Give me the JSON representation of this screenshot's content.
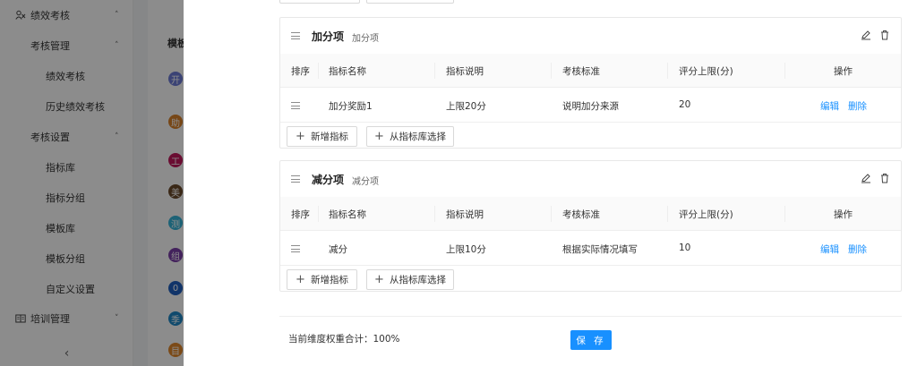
{
  "sidebar": {
    "items": [
      {
        "label": "绩效考核",
        "icon": "performance-icon",
        "chevron": "˄"
      },
      {
        "label": "考核管理",
        "chevron": "˄"
      },
      {
        "label": "绩效考核"
      },
      {
        "label": "历史绩效考核"
      },
      {
        "label": "考核设置",
        "chevron": "˄"
      },
      {
        "label": "指标库"
      },
      {
        "label": "指标分组"
      },
      {
        "label": "模板库"
      },
      {
        "label": "模板分组"
      },
      {
        "label": "自定义设置"
      },
      {
        "label": "培训管理",
        "icon": "book-icon",
        "chevron": "˅"
      }
    ],
    "collapse_label": "‹"
  },
  "background": {
    "column_header": "模板",
    "avatars": [
      {
        "char": "开",
        "color": "#6c7bd6"
      },
      {
        "char": "助",
        "color": "#d9822b"
      },
      {
        "char": "工",
        "color": "#c2185b"
      },
      {
        "char": "美",
        "color": "#6b4a2b"
      },
      {
        "char": "测",
        "color": "#35b3d8"
      },
      {
        "char": "组",
        "color": "#7b3ea8"
      },
      {
        "char": "0",
        "color": "#1f5fbf"
      },
      {
        "char": "季",
        "color": "#1e88c7"
      },
      {
        "char": "目",
        "color": "#e0872a"
      }
    ]
  },
  "sections": [
    {
      "title": "加分项",
      "subtitle": "加分项",
      "columns": [
        "排序",
        "指标名称",
        "指标说明",
        "考核标准",
        "评分上限(分)",
        "操作"
      ],
      "rows": [
        {
          "name": "加分奖励1",
          "desc": "上限20分",
          "standard": "说明加分来源",
          "max": "20",
          "edit": "编辑",
          "delete": "删除"
        }
      ],
      "add_label": "新增指标",
      "library_label": "从指标库选择"
    },
    {
      "title": "减分项",
      "subtitle": "减分项",
      "columns": [
        "排序",
        "指标名称",
        "指标说明",
        "考核标准",
        "评分上限(分)",
        "操作"
      ],
      "rows": [
        {
          "name": "减分",
          "desc": "上限10分",
          "standard": "根据实际情况填写",
          "max": "10",
          "edit": "编辑",
          "delete": "删除"
        }
      ],
      "add_label": "新增指标",
      "library_label": "从指标库选择"
    }
  ],
  "footer": {
    "weight_total": "当前维度权重合计：100%",
    "save_label": "保 存"
  },
  "colors": {
    "primary": "#1890ff",
    "mask": "rgba(0,0,0,0.45)"
  }
}
